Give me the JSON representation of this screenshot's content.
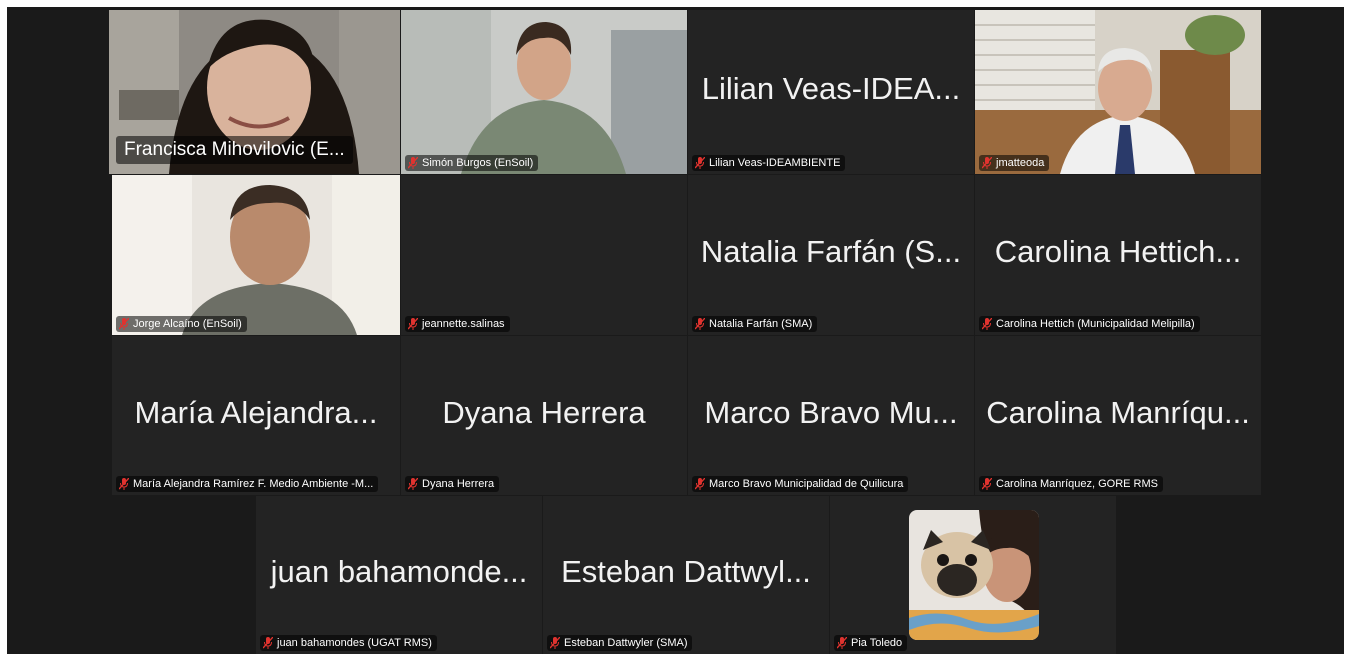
{
  "participants": [
    {
      "id": "francisca",
      "label": "Francisca Mihovilovic (E...",
      "big_name": "",
      "muted": false,
      "active": true,
      "video": true
    },
    {
      "id": "simon",
      "label": "Simón Burgos (EnSoil)",
      "big_name": "",
      "muted": true,
      "active": false,
      "video": true
    },
    {
      "id": "lilian",
      "label": "Lilian Veas-IDEAMBIENTE",
      "big_name": "Lilian Veas-IDEA...",
      "muted": true,
      "active": false,
      "video": false
    },
    {
      "id": "jmatteoda",
      "label": "jmatteoda",
      "big_name": "",
      "muted": true,
      "active": false,
      "video": true
    },
    {
      "id": "jorge",
      "label": "Jorge Alcaíno (EnSoil)",
      "big_name": "",
      "muted": true,
      "active": false,
      "video": true
    },
    {
      "id": "jeannette",
      "label": "jeannette.salinas",
      "big_name": "",
      "muted": true,
      "active": false,
      "video": false
    },
    {
      "id": "natalia",
      "label": "Natalia Farfán (SMA)",
      "big_name": "Natalia Farfán (S...",
      "muted": true,
      "active": false,
      "video": false
    },
    {
      "id": "carolina-h",
      "label": "Carolina Hettich (Municipalidad Melipilla)",
      "big_name": "Carolina Hettich...",
      "muted": true,
      "active": false,
      "video": false
    },
    {
      "id": "maria",
      "label": "María Alejandra Ramírez F. Medio Ambiente -M...",
      "big_name": "María Alejandra...",
      "muted": true,
      "active": false,
      "video": false
    },
    {
      "id": "dyana",
      "label": "Dyana Herrera",
      "big_name": "Dyana Herrera",
      "muted": true,
      "active": false,
      "video": false
    },
    {
      "id": "marco",
      "label": "Marco Bravo Municipalidad de Quilicura",
      "big_name": "Marco Bravo Mu...",
      "muted": true,
      "active": false,
      "video": false
    },
    {
      "id": "carolina-m",
      "label": "Carolina Manríquez, GORE RMS",
      "big_name": "Carolina Manríqu...",
      "muted": true,
      "active": false,
      "video": false
    },
    {
      "id": "juan",
      "label": "juan bahamondes (UGAT RMS)",
      "big_name": "juan bahamonde...",
      "muted": true,
      "active": false,
      "video": false
    },
    {
      "id": "esteban",
      "label": "Esteban Dattwyler (SMA)",
      "big_name": "Esteban Dattwyl...",
      "muted": true,
      "active": false,
      "video": false
    },
    {
      "id": "pia",
      "label": "Pia Toledo",
      "big_name": "",
      "muted": true,
      "active": false,
      "video": false,
      "avatar": true
    }
  ],
  "colors": {
    "active_border": "#3fcf5a",
    "muted_icon": "#e0332f",
    "tile": "#232323",
    "stage": "#1a1a1a"
  }
}
